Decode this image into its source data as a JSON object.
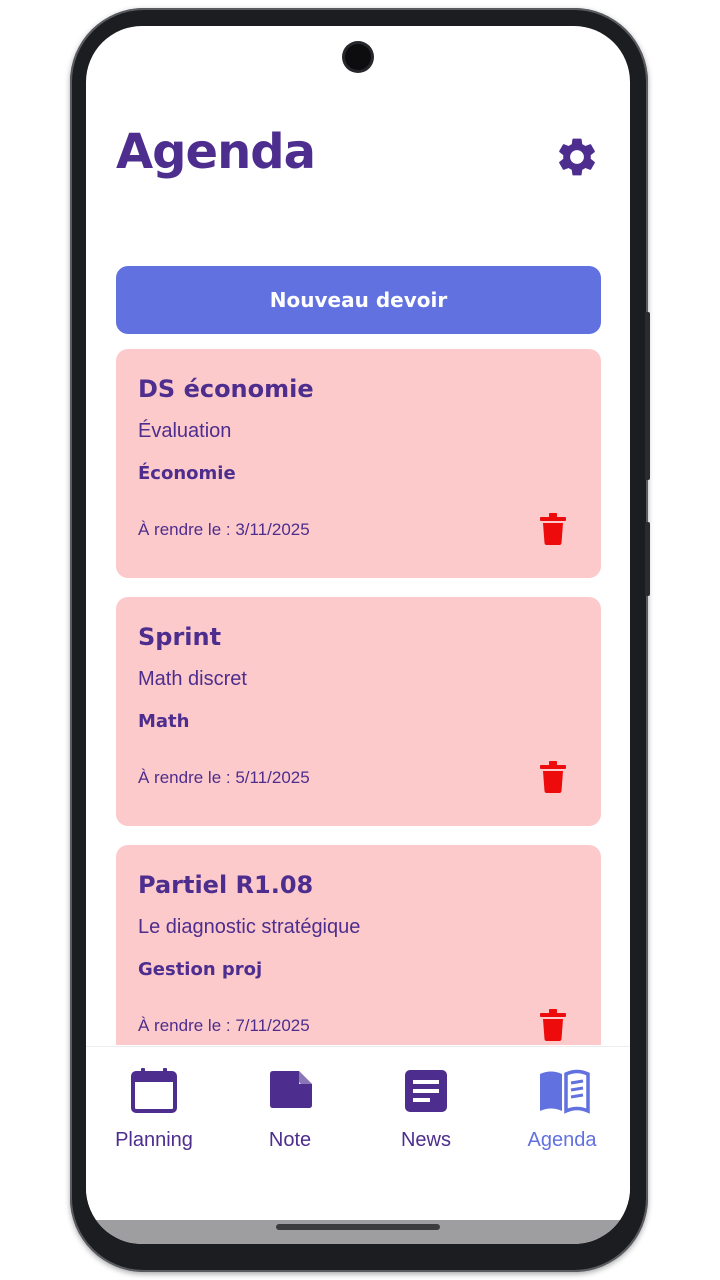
{
  "header": {
    "title": "Agenda",
    "settings_icon": "gear-icon"
  },
  "actions": {
    "new_label": "Nouveau devoir"
  },
  "assignments": [
    {
      "title": "DS économie",
      "description": "Évaluation",
      "subject": "Économie",
      "due": "À rendre le : 3/11/2025",
      "delete_icon": "trash-icon"
    },
    {
      "title": "Sprint",
      "description": "Math discret",
      "subject": "Math",
      "due": "À rendre le : 5/11/2025",
      "delete_icon": "trash-icon"
    },
    {
      "title": "Partiel R1.08",
      "description": "Le diagnostic stratégique",
      "subject": "Gestion proj",
      "due": "À rendre le : 7/11/2025",
      "delete_icon": "trash-icon"
    }
  ],
  "tabbar": {
    "items": [
      {
        "label": "Planning",
        "icon": "calendar-icon",
        "active": false
      },
      {
        "label": "Note",
        "icon": "note-icon",
        "active": false
      },
      {
        "label": "News",
        "icon": "news-icon",
        "active": false
      },
      {
        "label": "Agenda",
        "icon": "book-icon",
        "active": true
      }
    ]
  },
  "colors": {
    "accent": "#4d2d8e",
    "button": "#6171df",
    "card": "#fccacb",
    "delete": "#ee0b0b",
    "active_tab": "#6171df"
  }
}
